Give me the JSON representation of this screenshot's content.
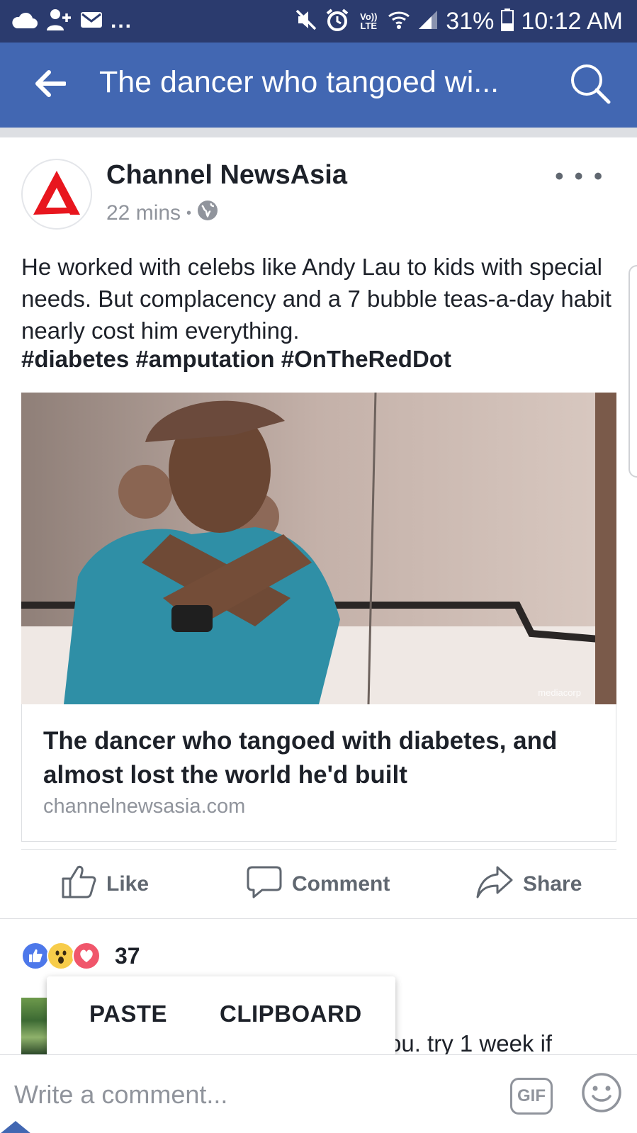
{
  "status_bar": {
    "left_more": "...",
    "network": "Vo)) LTE",
    "battery": "31%",
    "time": "10:12 AM"
  },
  "app_bar": {
    "title": "The dancer who tangoed wi...",
    "back_icon": "arrow-left-icon",
    "search_icon": "search-icon"
  },
  "post": {
    "page_name": "Channel NewsAsia",
    "time": "22 mins",
    "separator": "•",
    "privacy_icon": "globe-icon",
    "more": "• • •",
    "text": "He worked with celebs like Andy Lau to kids with special needs. But complacency and a 7 bubble teas-a-day habit nearly cost him everything.",
    "hashtags": "#diabetes #amputation #OnTheRedDot",
    "link": {
      "image_watermark": "mediacorp",
      "title": "The dancer who tangoed with diabetes, and almost lost the world he'd built",
      "domain": "channelnewsasia.com"
    }
  },
  "actions": {
    "like": "Like",
    "comment": "Comment",
    "share": "Share"
  },
  "reactions": {
    "icons": [
      "like-reaction-icon",
      "wow-reaction-icon",
      "love-reaction-icon"
    ],
    "count": "37"
  },
  "comment_preview": {
    "snippet": "ou. try 1 week if"
  },
  "paste_popup": {
    "paste": "PASTE",
    "clipboard": "CLIPBOARD"
  },
  "composer": {
    "placeholder": "Write a comment...",
    "gif": "GIF"
  },
  "colors": {
    "status_bar": "#2b3b6e",
    "app_bar": "#4267b2",
    "text_primary": "#1d2129",
    "text_secondary": "#90949c",
    "cna_red": "#e8161e"
  }
}
